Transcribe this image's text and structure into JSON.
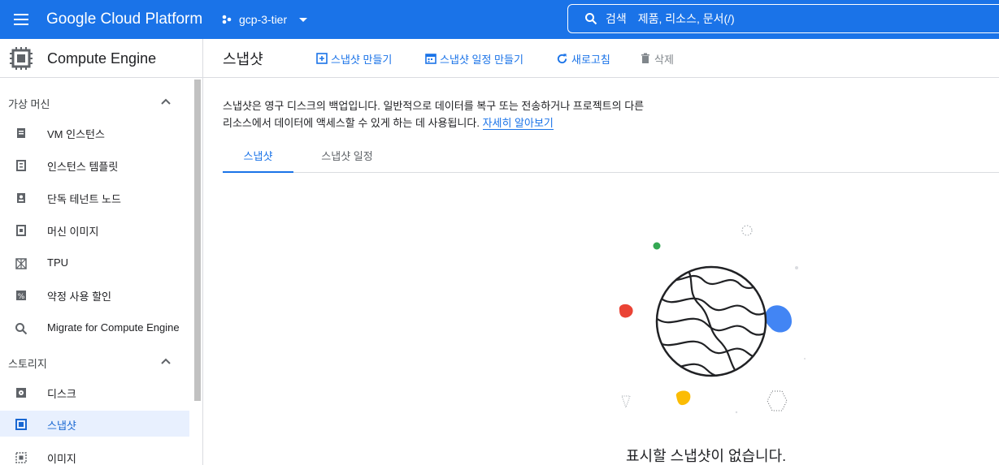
{
  "topbar": {
    "app_title": "Google Cloud Platform",
    "project_name": "gcp-3-tier",
    "search_label": "검색",
    "search_placeholder": "제품, 리소스, 문서(/)"
  },
  "sidebar": {
    "product_title": "Compute Engine",
    "sections": [
      {
        "label": "가상 머신",
        "items": [
          {
            "label": "VM 인스턴스",
            "icon": "vm-icon"
          },
          {
            "label": "인스턴스 템플릿",
            "icon": "template-icon"
          },
          {
            "label": "단독 테넌트 노드",
            "icon": "sole-tenant-icon"
          },
          {
            "label": "머신 이미지",
            "icon": "machine-image-icon"
          },
          {
            "label": "TPU",
            "icon": "tpu-icon"
          },
          {
            "label": "약정 사용 할인",
            "icon": "percent-icon"
          },
          {
            "label": "Migrate for Compute Engine",
            "icon": "search-icon"
          }
        ]
      },
      {
        "label": "스토리지",
        "items": [
          {
            "label": "디스크",
            "icon": "disk-icon"
          },
          {
            "label": "스냅샷",
            "icon": "snapshot-icon",
            "active": true
          },
          {
            "label": "이미지",
            "icon": "image-icon"
          }
        ]
      }
    ]
  },
  "toolbar": {
    "page_title": "스냅샷",
    "create_snapshot": "스냅샷 만들기",
    "create_schedule": "스냅샷 일정 만들기",
    "refresh": "새로고침",
    "delete": "삭제"
  },
  "description": {
    "text": "스냅샷은 영구 디스크의 백업입니다. 일반적으로 데이터를 복구 또는 전송하거나 프로젝트의 다른 리소스에서 데이터에 액세스할 수 있게 하는 데 사용됩니다.",
    "learn_more": "자세히 알아보기"
  },
  "tabs": [
    {
      "label": "스냅샷",
      "active": true
    },
    {
      "label": "스냅샷 일정",
      "active": false
    }
  ],
  "empty_state": {
    "message": "표시할 스냅샷이 없습니다."
  },
  "colors": {
    "brand_blue": "#1a73e8",
    "active_bg": "#e8f0fe",
    "dot_green": "#34a853",
    "dot_red": "#ea4335",
    "dot_yellow": "#fbbc04",
    "blob_blue": "#4285f4"
  }
}
